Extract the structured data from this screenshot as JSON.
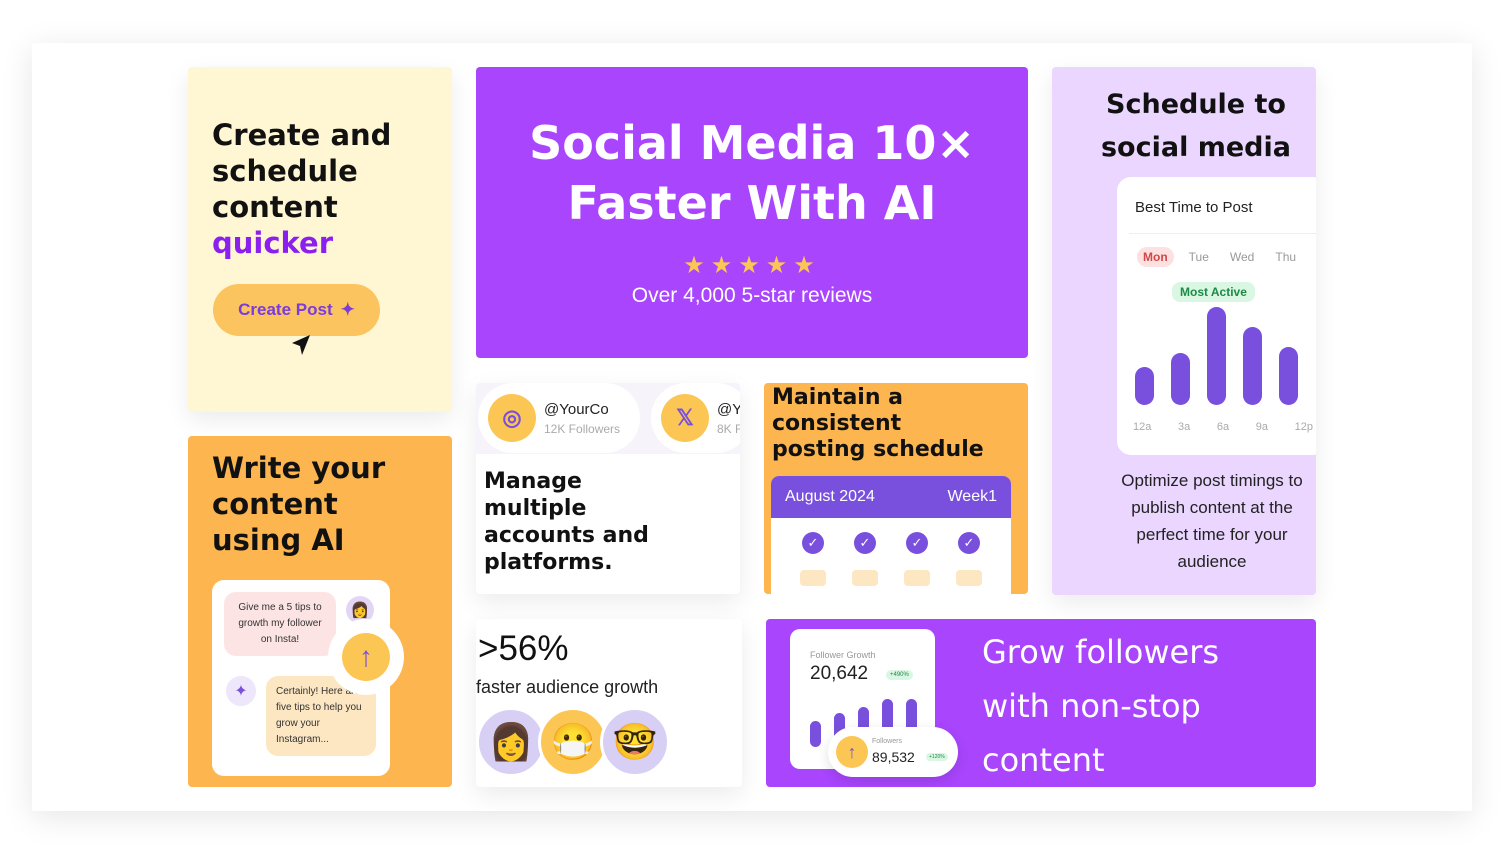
{
  "card_create": {
    "title_line1": "Create and",
    "title_line2": "schedule",
    "title_line3": "content",
    "title_accent": "quicker",
    "button_label": "Create Post",
    "button_icon": "sparkle-icon",
    "cursor_icon": "cursor-arrow-icon"
  },
  "hero": {
    "title_line1": "Social Media 10×",
    "title_line2": "Faster With AI",
    "stars": "★★★★★",
    "rating": 5,
    "reviews": "Over 4,000 5-star reviews",
    "bg_color": "#a845fd"
  },
  "schedule": {
    "title_line1": "Schedule to",
    "title_line2": "social media",
    "panel_title": "Best Time to Post",
    "days": [
      "Mon",
      "Tue",
      "Wed",
      "Thu"
    ],
    "badge": "Most Active",
    "times": [
      "12a",
      "3a",
      "6a",
      "9a",
      "12p"
    ],
    "description": "Optimize post timings to publish content at the perfect time for your audience"
  },
  "write": {
    "title_line1": "Write your",
    "title_line2": "content",
    "title_line3": "using AI",
    "question": "Give me a 5 tips to growth my follower on Insta!",
    "answer": "Certainly! Here are five tips to help you grow your Instagram...",
    "send_icon": "arrow-up-icon"
  },
  "accounts": {
    "items": [
      {
        "handle": "@YourCo",
        "followers": "12K Followers",
        "icon": "instagram-icon",
        "glyph": "◎"
      },
      {
        "handle": "@Y",
        "followers": "8K F",
        "icon": "x-icon",
        "glyph": "𝕏"
      }
    ],
    "title_line1": "Manage",
    "title_line2": "multiple",
    "title_line3": "accounts and",
    "title_line4": "platforms."
  },
  "maintain": {
    "title_line1": "Maintain a",
    "title_line2": "consistent",
    "title_line3": "posting schedule",
    "month": "August 2024",
    "week": "Week1",
    "check": "✓"
  },
  "growth": {
    "stat": ">56%",
    "label": "faster audience growth",
    "avatars": [
      "👩",
      "😷",
      "🤓"
    ]
  },
  "followers": {
    "growth_label": "Follower Growth",
    "growth_value": "20,642",
    "growth_badge": "+490%",
    "followers_label": "Followers",
    "followers_value": "89,532",
    "followers_badge": "+120%",
    "title_line1": "Grow followers",
    "title_line2": "with non-stop",
    "title_line3": "content"
  }
}
